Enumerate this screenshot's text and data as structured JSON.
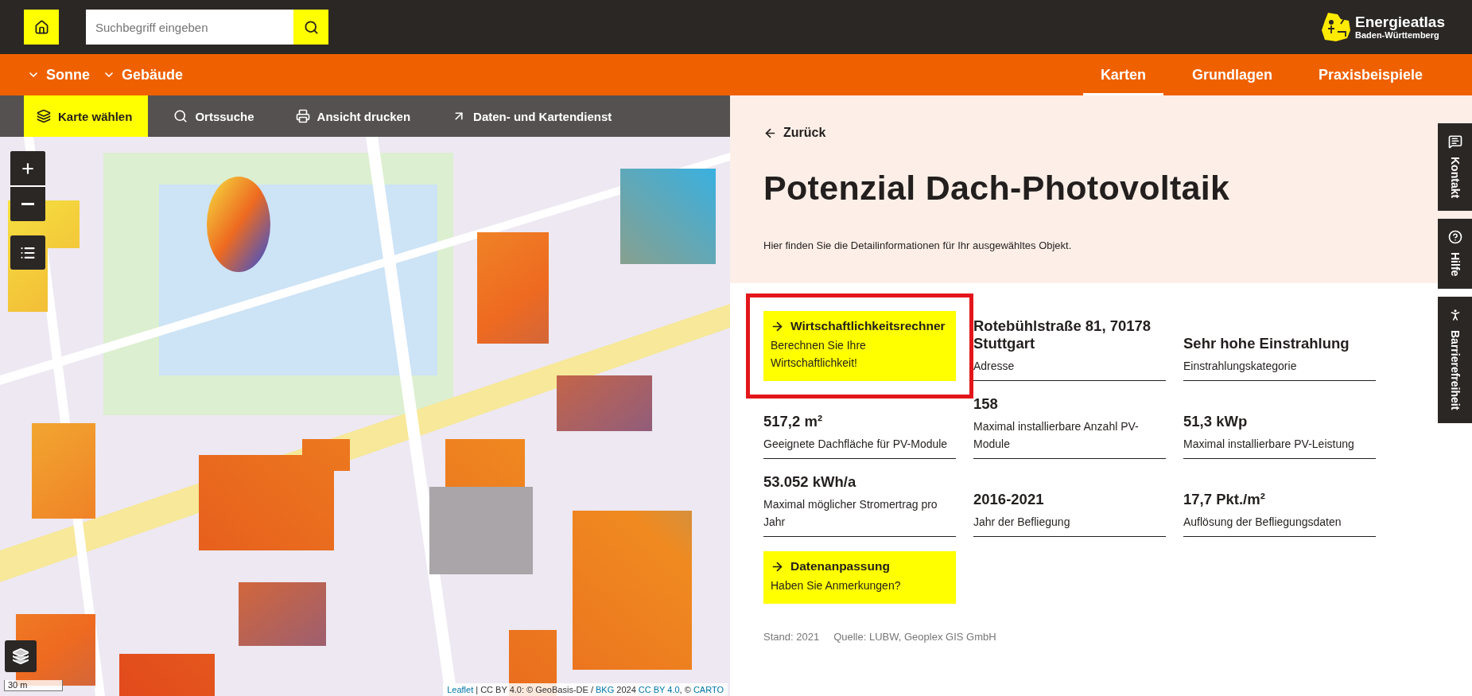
{
  "header": {
    "search": {
      "placeholder": "Suchbegriff eingeben"
    },
    "logo": {
      "title": "Energieatlas",
      "subtitle": "Baden-Württemberg"
    }
  },
  "nav": {
    "menus": [
      {
        "label": "Sonne"
      },
      {
        "label": "Gebäude"
      }
    ],
    "links": [
      {
        "label": "Karten",
        "selected": true
      },
      {
        "label": "Grundlagen",
        "selected": false
      },
      {
        "label": "Praxisbeispiele",
        "selected": false
      }
    ]
  },
  "map_toolbar": [
    {
      "label": "Karte wählen",
      "selected": true
    },
    {
      "label": "Ortssuche",
      "selected": false
    },
    {
      "label": "Ansicht drucken",
      "selected": false
    },
    {
      "label": "Daten- und Kartendienst",
      "selected": false
    }
  ],
  "map": {
    "kind": "picture",
    "scale": "30 m",
    "attribution": [
      {
        "text": "Leaflet",
        "kind": "link"
      },
      {
        "text": " | CC BY 4.0: © GeoBasis-DE / ",
        "kind": "text"
      },
      {
        "text": "BKG",
        "kind": "link"
      },
      {
        "text": " 2024 ",
        "kind": "text"
      },
      {
        "text": "CC BY 4.0",
        "kind": "link"
      },
      {
        "text": ", © ",
        "kind": "text"
      },
      {
        "text": "CARTO",
        "kind": "link"
      }
    ]
  },
  "panel": {
    "back": "Zurück",
    "title": "Potenzial Dach-Photovoltaik",
    "intro": "Hier finden Sie die Detailinformationen für Ihr ausgewähltes Objekt.",
    "cells": [
      {
        "kind": "action",
        "title": "Wirtschaftlichkeitsrechner",
        "text": "Berechnen Sie Ihre Wirtschaftlichkeit!",
        "highlighted": true
      },
      {
        "kind": "fact",
        "value": "Rotebühlstraße 81, 70178 Stuttgart",
        "label": "Adresse"
      },
      {
        "kind": "fact",
        "value": "Sehr hohe Einstrahlung",
        "label": "Einstrahlungskategorie"
      },
      {
        "kind": "fact",
        "value": "517,2 m²",
        "label": "Geeignete Dachfläche für PV-Module"
      },
      {
        "kind": "fact",
        "value": "158",
        "label": "Maximal installierbare Anzahl PV-Module"
      },
      {
        "kind": "fact",
        "value": "51,3 kWp",
        "label": "Maximal installierbare PV-Leistung"
      },
      {
        "kind": "fact",
        "value": "53.052 kWh/a",
        "label": "Maximal möglicher Stromertrag pro Jahr"
      },
      {
        "kind": "fact",
        "value": "2016-2021",
        "label": "Jahr der Befliegung"
      },
      {
        "kind": "fact",
        "value": "17,7 Pkt./m²",
        "label": "Auflösung der Befliegungsdaten"
      },
      {
        "kind": "action",
        "title": "Datenanpassung",
        "text": "Haben Sie Anmerkungen?",
        "highlighted": false
      }
    ],
    "footer": [
      "Stand: 2021",
      "Quelle: LUBW, Geoplex GIS GmbH"
    ]
  },
  "side_tabs": [
    {
      "label": "Kontakt"
    },
    {
      "label": "Hilfe"
    },
    {
      "label": "Barrierefreiheit"
    }
  ]
}
